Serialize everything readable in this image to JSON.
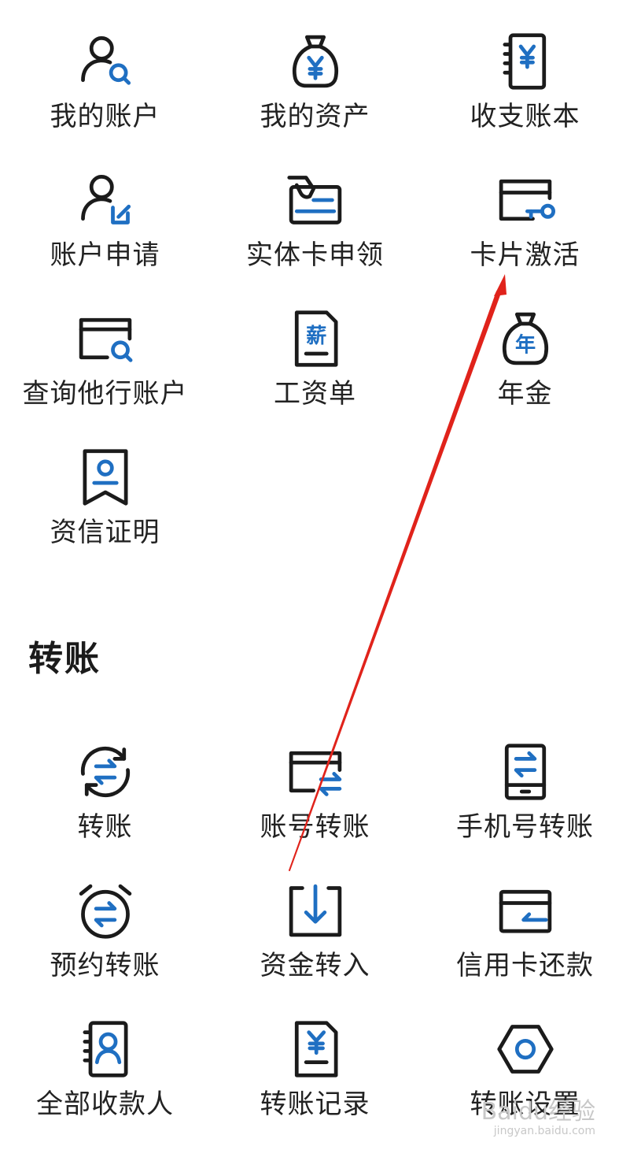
{
  "account_section": {
    "items": [
      {
        "label": "我的账户",
        "icon": "user-search-icon"
      },
      {
        "label": "我的资产",
        "icon": "money-bag-yen-icon"
      },
      {
        "label": "收支账本",
        "icon": "ledger-yen-icon"
      },
      {
        "label": "账户申请",
        "icon": "user-edit-icon"
      },
      {
        "label": "实体卡申领",
        "icon": "card-hand-icon"
      },
      {
        "label": "卡片激活",
        "icon": "card-key-icon"
      },
      {
        "label": "查询他行账户",
        "icon": "card-search-icon"
      },
      {
        "label": "工资单",
        "icon": "salary-doc-icon"
      },
      {
        "label": "年金",
        "icon": "money-bag-annuity-icon"
      },
      {
        "label": "资信证明",
        "icon": "credit-certificate-icon"
      }
    ],
    "salary_glyph": "薪",
    "annuity_glyph": "年",
    "yen_glyph": "¥"
  },
  "transfer_section": {
    "title": "转账",
    "items": [
      {
        "label": "转账",
        "icon": "transfer-cycle-icon"
      },
      {
        "label": "账号转账",
        "icon": "card-transfer-icon"
      },
      {
        "label": "手机号转账",
        "icon": "phone-transfer-icon"
      },
      {
        "label": "预约转账",
        "icon": "alarm-transfer-icon"
      },
      {
        "label": "资金转入",
        "icon": "funds-in-icon"
      },
      {
        "label": "信用卡还款",
        "icon": "credit-card-repay-icon"
      },
      {
        "label": "全部收款人",
        "icon": "contacts-book-icon"
      },
      {
        "label": "转账记录",
        "icon": "transfer-record-icon"
      },
      {
        "label": "转账设置",
        "icon": "settings-hexagon-icon"
      }
    ]
  },
  "watermark": {
    "main": "Baidu经验",
    "sub": "jingyan.baidu.com"
  },
  "colors": {
    "accent": "#1f6fc2",
    "annotation_arrow": "#e0231b",
    "text": "#222222"
  }
}
